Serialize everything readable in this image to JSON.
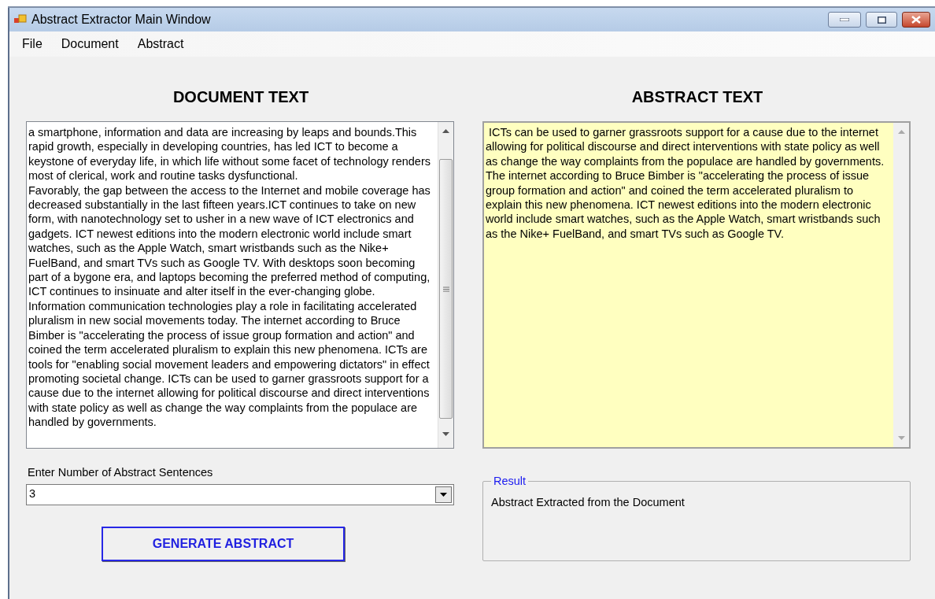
{
  "window": {
    "title": "Abstract Extractor Main Window"
  },
  "menu": [
    "File",
    "Document",
    "Abstract"
  ],
  "document": {
    "heading": "DOCUMENT TEXT",
    "paragraphs": [
      "a smartphone, information and data are increasing by leaps and bounds.This rapid growth, especially in developing countries, has led ICT to become a keystone of everyday life, in which life without some facet of technology renders most of clerical, work and routine tasks dysfunctional.",
      "Favorably, the gap between the access to the Internet and mobile coverage has decreased substantially in the last fifteen years.ICT continues to take on new form, with nanotechnology set to usher in a new wave of ICT electronics and gadgets. ICT newest editions into the modern electronic world include smart watches, such as the Apple Watch, smart wristbands such as the Nike+ FuelBand, and smart TVs such as Google TV. With desktops soon becoming part of a bygone era, and laptops becoming the preferred method of computing, ICT continues to insinuate and alter itself in the ever-changing globe.",
      "Information communication technologies play a role in facilitating accelerated pluralism in new social movements today. The internet according to Bruce Bimber is \"accelerating the process of issue group formation and action\" and coined the term accelerated pluralism to explain this new phenomena. ICTs are tools for \"enabling social movement leaders and empowering dictators\" in effect promoting societal change. ICTs can be used to garner grassroots support for a cause due to the internet allowing for political discourse and direct interventions with state policy as well as change the way complaints from the populace are handled by governments."
    ]
  },
  "abstract": {
    "heading": "ABSTRACT TEXT",
    "text": " ICTs can be used to garner grassroots support for a cause due to the internet allowing for political discourse and direct interventions with state policy as well as change the way complaints from the populace are handled by governments. The internet according to Bruce Bimber is \"accelerating the process of issue group formation and action\" and coined the term accelerated pluralism to explain this new phenomena. ICT newest editions into the modern electronic world include smart watches, such as the Apple Watch, smart wristbands such as the Nike+ FuelBand, and smart TVs such as Google TV."
  },
  "sentences": {
    "label": "Enter Number of Abstract Sentences",
    "value": "3"
  },
  "generate_button": "GENERATE ABSTRACT",
  "result": {
    "legend": "Result",
    "text": "Abstract Extracted from the Document"
  }
}
